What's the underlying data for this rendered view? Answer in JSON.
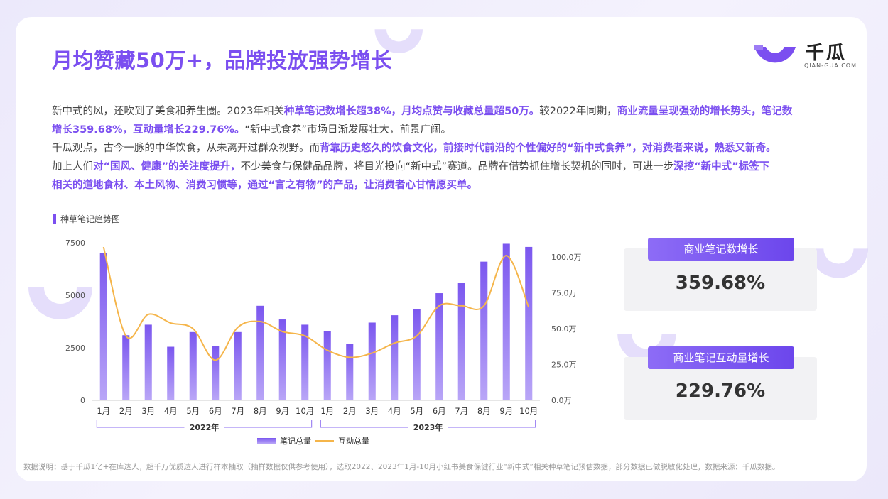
{
  "title": "月均赞藏50万+，品牌投放强势增长",
  "brand": {
    "name": "千瓜",
    "sub": "QIAN-GUA.COM"
  },
  "paragraph": {
    "line1": [
      {
        "t": "新中式的风，还吹到了美食和养生圈。2023年相关",
        "h": false
      },
      {
        "t": "种草笔记数增长超38%，月均点赞与收藏总量超50万。",
        "h": true
      },
      {
        "t": "较2022年同期，",
        "h": false
      },
      {
        "t": "商业流量呈现强劲的增长势头，笔记数",
        "h": true
      }
    ],
    "line2": [
      {
        "t": "增长359.68%，互动量增长229.76%。",
        "h": true
      },
      {
        "t": "“新中式食养”市场日渐发展壮大，前景广阔。",
        "h": false
      }
    ],
    "line3": [
      {
        "t": "千瓜观点，古今一脉的中华饮食，从未离开过群众视野。而",
        "h": false
      },
      {
        "t": "背靠历史悠久的饮食文化，前接时代前沿的个性偏好的“新中式食养”，对消费者来说，熟悉又新奇。",
        "h": true
      }
    ],
    "line4": [
      {
        "t": "加上人们",
        "h": false
      },
      {
        "t": "对“国风、健康”的关注度提升，",
        "h": true
      },
      {
        "t": "不少美食与保健品品牌，将目光投向“新中式”赛道。品牌在借势抓住增长契机的同时，可进一步",
        "h": false
      },
      {
        "t": "深挖“新中式”标签下",
        "h": true
      }
    ],
    "line5": [
      {
        "t": "相关的道地食材、本土风物、消费习惯等，通过“言之有物”的产品，让消费者心甘情愿买单。",
        "h": true
      }
    ]
  },
  "chart_label": "种草笔记趋势图",
  "chart_data": {
    "type": "bar",
    "categories": [
      "1月",
      "2月",
      "3月",
      "4月",
      "5月",
      "6月",
      "7月",
      "8月",
      "9月",
      "10月",
      "1月",
      "2月",
      "3月",
      "4月",
      "5月",
      "6月",
      "7月",
      "8月",
      "9月",
      "10月"
    ],
    "groups": [
      {
        "label": "2022年",
        "from": 0,
        "to": 9
      },
      {
        "label": "2023年",
        "from": 10,
        "to": 19
      }
    ],
    "yleft": {
      "ticks": [
        "0",
        "2500",
        "5000",
        "7500"
      ],
      "ylim": [
        0,
        7500
      ]
    },
    "yright": {
      "ticks": [
        "0.0万",
        "25.0万",
        "50.0万",
        "75.0万",
        "100.0万"
      ],
      "ylim": [
        0,
        110
      ]
    },
    "series": [
      {
        "name": "笔记总量",
        "type": "bar",
        "axis": "left",
        "color": "#7b57ef",
        "values": [
          7000,
          3100,
          3600,
          2550,
          3250,
          2600,
          3250,
          4500,
          3850,
          3600,
          3300,
          2700,
          3700,
          4050,
          4350,
          5100,
          5600,
          6600,
          7450,
          7300
        ]
      },
      {
        "name": "互动总量",
        "type": "line",
        "axis": "right",
        "color": "#f5b54a",
        "values": [
          107,
          45,
          60,
          54,
          50,
          28,
          51,
          55,
          48,
          45,
          35,
          30,
          33,
          40,
          45,
          66,
          66,
          66,
          101,
          65
        ]
      }
    ]
  },
  "stats": [
    {
      "label": "商业笔记数增长",
      "value": "359.68%"
    },
    {
      "label": "商业笔记互动量增长",
      "value": "229.76%"
    }
  ],
  "footnote": "数据说明：基于千瓜1亿+在库达人，超千万优质达人进行样本抽取（抽样数据仅供参考使用），选取2022、2023年1月-10月小红书美食保健行业“新中式”相关种草笔记预估数据，部分数据已做脱敏化处理，数据来源：千瓜数据。"
}
